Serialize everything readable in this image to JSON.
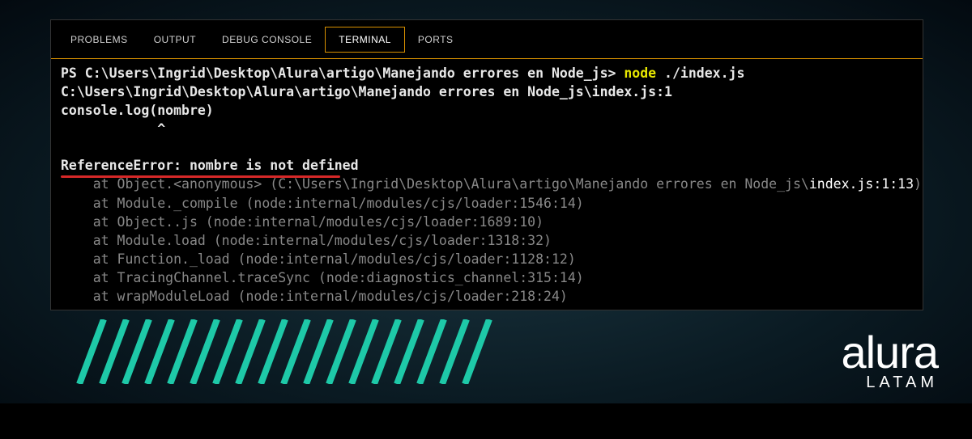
{
  "tabs": {
    "problems": "PROBLEMS",
    "output": "OUTPUT",
    "debug": "DEBUG CONSOLE",
    "terminal": "TERMINAL",
    "ports": "PORTS",
    "active": "terminal"
  },
  "terminal": {
    "prompt": "PS C:\\Users\\Ingrid\\Desktop\\Alura\\artigo\\Manejando errores en Node_js> ",
    "cmd_node": "node",
    "cmd_arg": " ./index.js",
    "path_line": "C:\\Users\\Ingrid\\Desktop\\Alura\\artigo\\Manejando errores en Node_js\\index.js:1",
    "code_line": "console.log(nombre)",
    "caret_line": "            ^",
    "error_line": "ReferenceError: nombre is not defined",
    "stack": [
      {
        "prefix": "    at Object.<anonymous> ",
        "gray1": "(C:\\Users\\Ingrid\\Desktop\\Alura\\artigo\\Manejando errores en Node_js\\",
        "bright": "index.js:1:13",
        "gray2": ")"
      },
      {
        "full": "    at Module._compile (node:internal/modules/cjs/loader:1546:14)"
      },
      {
        "full": "    at Object..js (node:internal/modules/cjs/loader:1689:10)"
      },
      {
        "full": "    at Module.load (node:internal/modules/cjs/loader:1318:32)"
      },
      {
        "full": "    at Function._load (node:internal/modules/cjs/loader:1128:12)"
      },
      {
        "full": "    at TracingChannel.traceSync (node:diagnostics_channel:315:14)"
      },
      {
        "full": "    at wrapModuleLoad (node:internal/modules/cjs/loader:218:24)"
      }
    ]
  },
  "logo": {
    "main": "alura",
    "sub": "LATAM"
  }
}
